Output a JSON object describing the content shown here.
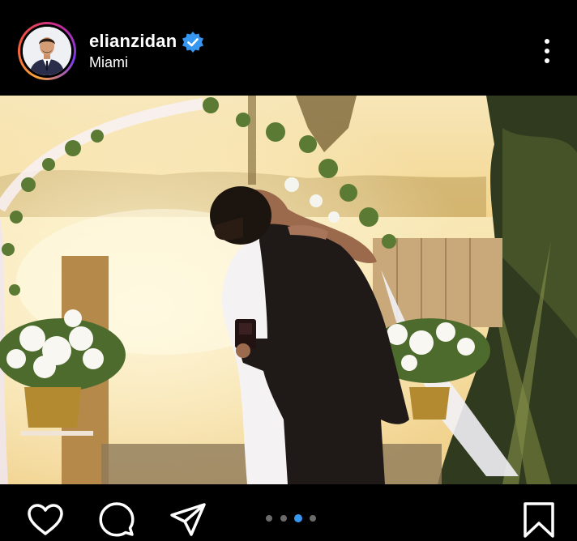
{
  "post": {
    "username": "elianzidan",
    "location": "Miami",
    "verified": true
  },
  "carousel": {
    "total": 4,
    "active_index": 2
  },
  "colors": {
    "verified_badge": "#3797f0",
    "carousel_active": "#3797f0",
    "carousel_inactive": "#6b6b6b"
  },
  "icons": {
    "more": "more-vertical-icon",
    "like": "heart-icon",
    "comment": "comment-icon",
    "share": "send-icon",
    "save": "bookmark-icon"
  }
}
